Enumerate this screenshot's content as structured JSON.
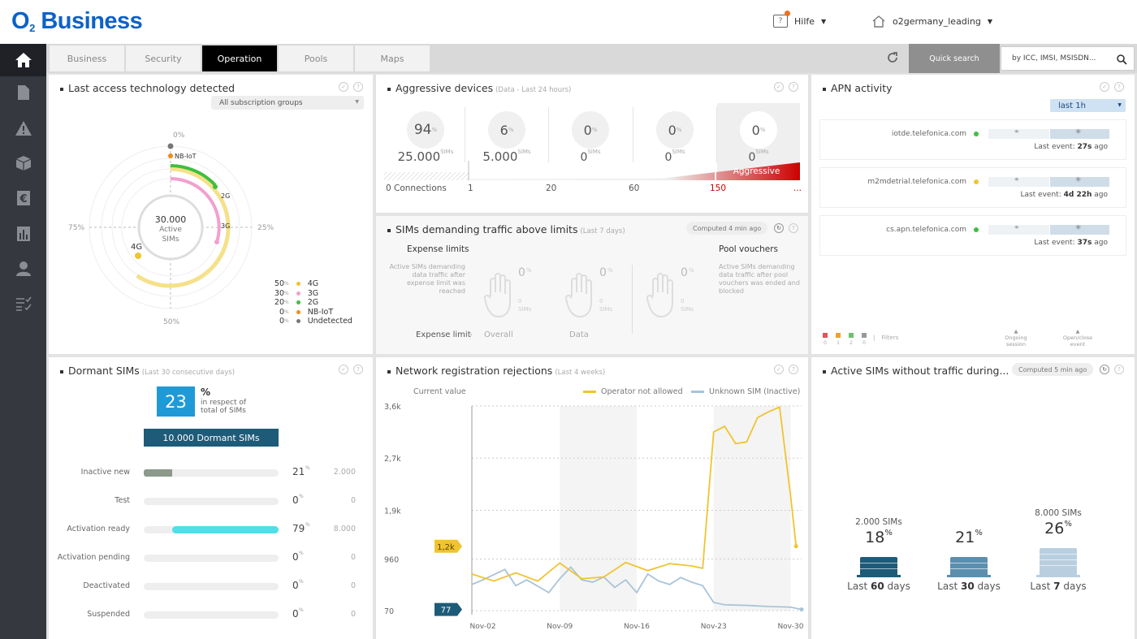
{
  "header": {
    "brand": "O",
    "brand_sub": "2",
    "brand_name": "Business",
    "help": "Hilfe",
    "account": "o2germany_leading"
  },
  "tabs": [
    "Business",
    "Security",
    "Operation",
    "Pools",
    "Maps"
  ],
  "search": {
    "label": "Quick search",
    "placeholder": "by ICC, IMSI, MSISDN..."
  },
  "colors": {
    "accent": "#0d62c8",
    "yellow": "#f0c430",
    "gray": "#9aa0a6",
    "aggressive": "#cc0000",
    "teal": "#1e5b79",
    "cyan": "#4fdfe8"
  },
  "access": {
    "title": "Last access technology detected",
    "filter": "All subscription groups",
    "center_value": "30.000",
    "center_l1": "Active",
    "center_l2": "SIMs",
    "pct0": "0%",
    "pct75": "75%",
    "pct25": "25%",
    "pct50": "50%",
    "ring_labels": {
      "nbiot": "NB-IoT",
      "g2": "2G",
      "g3": "3G",
      "g4": "4G"
    },
    "legend": [
      {
        "pct": "50",
        "name": "4G",
        "color": "#f0c430"
      },
      {
        "pct": "30",
        "name": "3G",
        "color": "#f2a0cf"
      },
      {
        "pct": "20",
        "name": "2G",
        "color": "#3fbf3f"
      },
      {
        "pct": "0",
        "name": "NB-IoT",
        "color": "#f08c1a"
      },
      {
        "pct": "0",
        "name": "Undetected",
        "color": "#777777"
      }
    ],
    "pct_sign": "%"
  },
  "aggressive": {
    "title": "Aggressive devices",
    "subtitle": "(Data - Last 24 hours)",
    "cols": [
      {
        "pct": "94",
        "sims": "25.000"
      },
      {
        "pct": "6",
        "sims": "5.000"
      },
      {
        "pct": "0",
        "sims": "0"
      },
      {
        "pct": "0",
        "sims": "0"
      },
      {
        "pct": "0",
        "sims": "0"
      }
    ],
    "sims_unit": "SIMs",
    "pct_sign": "%",
    "aggressive_label": "Aggressive",
    "scale": [
      "0  Connections",
      "1",
      "20",
      "60",
      "150",
      "..."
    ]
  },
  "traffic": {
    "title": "SIMs demanding traffic above limits",
    "subtitle": "(Last 7 days)",
    "computed": "Computed",
    "computed_val": "4 min ago",
    "expense_title": "Expense limits",
    "expense_desc": "Active SIMs demanding data traffic after expense limit was reached",
    "pool_title": "Pool vouchers",
    "pool_desc": "Active SIMs demanding data traffic after pool vouchers was ended and blocked",
    "hands": [
      {
        "pct": "0",
        "sims": "0"
      },
      {
        "pct": "0",
        "sims": "0"
      },
      {
        "pct": "0",
        "sims": "0"
      }
    ],
    "pct_sign": "%",
    "sims_unit": "SIMs",
    "crumb": "Expense limit",
    "crumb_sep": "›",
    "overall": "Overall",
    "data": "Data"
  },
  "apn": {
    "title": "APN activity",
    "range": "last 1h",
    "items": [
      {
        "name": "iotde.telefonica.com",
        "status": "#3fbf3f",
        "last": "Last event:",
        "time": "27s",
        "ago": "ago"
      },
      {
        "name": "m2mdetrial.telefonica.com",
        "status": "#f0c430",
        "last": "Last event:",
        "time": "4d 22h",
        "ago": "ago"
      },
      {
        "name": "cs.apn.telefonica.com",
        "status": "#3fbf3f",
        "last": "Last event:",
        "time": "37s",
        "ago": "ago"
      }
    ],
    "filters": [
      {
        "color": "#e05555",
        "n": "0"
      },
      {
        "color": "#f0a030",
        "n": "1"
      },
      {
        "color": "#6ac46a",
        "n": "2"
      },
      {
        "color": "#999999",
        "n": "0"
      }
    ],
    "filters_label": "Filters",
    "ongoing": "Ongoing session",
    "openclose": "Open/close event"
  },
  "dormant": {
    "title": "Dormant SIMs",
    "subtitle": "(Last 30 consecutive days)",
    "pct": "23",
    "pct_sign": "%",
    "respect": "in respect of total of SIMs",
    "button": "10.000  Dormant SIMs",
    "rows": [
      {
        "label": "Inactive new",
        "pct": "21",
        "count": "2.000",
        "value": 21,
        "color": "#8b9a8b",
        "offset": 0
      },
      {
        "label": "Test",
        "pct": "0",
        "count": "0",
        "value": 0,
        "color": "#8b9a8b",
        "offset": 0
      },
      {
        "label": "Activation ready",
        "pct": "79",
        "count": "8.000",
        "value": 79,
        "color": "#4fdfe8",
        "offset": 21
      },
      {
        "label": "Activation pending",
        "pct": "0",
        "count": "0",
        "value": 0,
        "color": "#8b9a8b",
        "offset": 0
      },
      {
        "label": "Deactivated",
        "pct": "0",
        "count": "0",
        "value": 0,
        "color": "#8b9a8b",
        "offset": 0
      },
      {
        "label": "Suspended",
        "pct": "0",
        "count": "0",
        "value": 0,
        "color": "#8b9a8b",
        "offset": 0
      }
    ]
  },
  "chart_data": {
    "type": "line",
    "title": "Network registration rejections",
    "subtitle": "(Last 4 weeks)",
    "current_label": "Current value",
    "ylim": [
      70,
      3600
    ],
    "y_ticks": [
      {
        "v": 3600,
        "label": "3,6k"
      },
      {
        "v": 2700,
        "label": "2,7k"
      },
      {
        "v": 1800,
        "label": "1,9k"
      },
      {
        "v": 960,
        "label": "960"
      },
      {
        "v": 70,
        "label": "70"
      }
    ],
    "x_ticks": [
      {
        "x": 2,
        "label": "Nov-02"
      },
      {
        "x": 9,
        "label": "Nov-09"
      },
      {
        "x": 16,
        "label": "Nov-16"
      },
      {
        "x": 23,
        "label": "Nov-23"
      },
      {
        "x": 30,
        "label": "Nov-30"
      }
    ],
    "x_range": [
      1,
      31
    ],
    "current": {
      "operator": "1,2k",
      "unknown": "77"
    },
    "series": [
      {
        "name": "Operator not allowed",
        "color": "#f0c430",
        "x": [
          1,
          3,
          5,
          7,
          9,
          11,
          13,
          15,
          17,
          19,
          21,
          22,
          23,
          24,
          25,
          26,
          27,
          28,
          29,
          30,
          30.5
        ],
        "y": [
          700,
          580,
          720,
          580,
          890,
          620,
          650,
          900,
          760,
          880,
          840,
          800,
          3150,
          3250,
          2950,
          2980,
          3400,
          3500,
          3580,
          2050,
          1180
        ]
      },
      {
        "name": "Unknown SIM (Inactive)",
        "color": "#a8c4da",
        "x": [
          1,
          2,
          4,
          5,
          6,
          8,
          9,
          10,
          11,
          12,
          13,
          14,
          15,
          16,
          17,
          18,
          19,
          20,
          21,
          22,
          23,
          24,
          26,
          28,
          30,
          31
        ],
        "y": [
          520,
          600,
          780,
          500,
          600,
          380,
          620,
          820,
          600,
          560,
          650,
          470,
          600,
          380,
          700,
          580,
          520,
          640,
          560,
          500,
          210,
          170,
          160,
          140,
          130,
          90
        ]
      }
    ]
  },
  "nottraffic": {
    "title": "Active SIMs without traffic during...",
    "computed": "Computed",
    "computed_val": "5 min ago",
    "cols": [
      {
        "sims": "2.000 SIMs",
        "pct": "18",
        "label": "Last",
        "days": "60",
        "unit": "days",
        "color": "#1e5b79"
      },
      {
        "sims": "",
        "pct": "21",
        "label": "Last",
        "days": "30",
        "unit": "days",
        "color": "#5b8fb0"
      },
      {
        "sims": "8.000 SIMs",
        "pct": "26",
        "label": "Last",
        "days": "7",
        "unit": "days",
        "color": "#b9cfe0"
      }
    ],
    "pct_sign": "%"
  }
}
